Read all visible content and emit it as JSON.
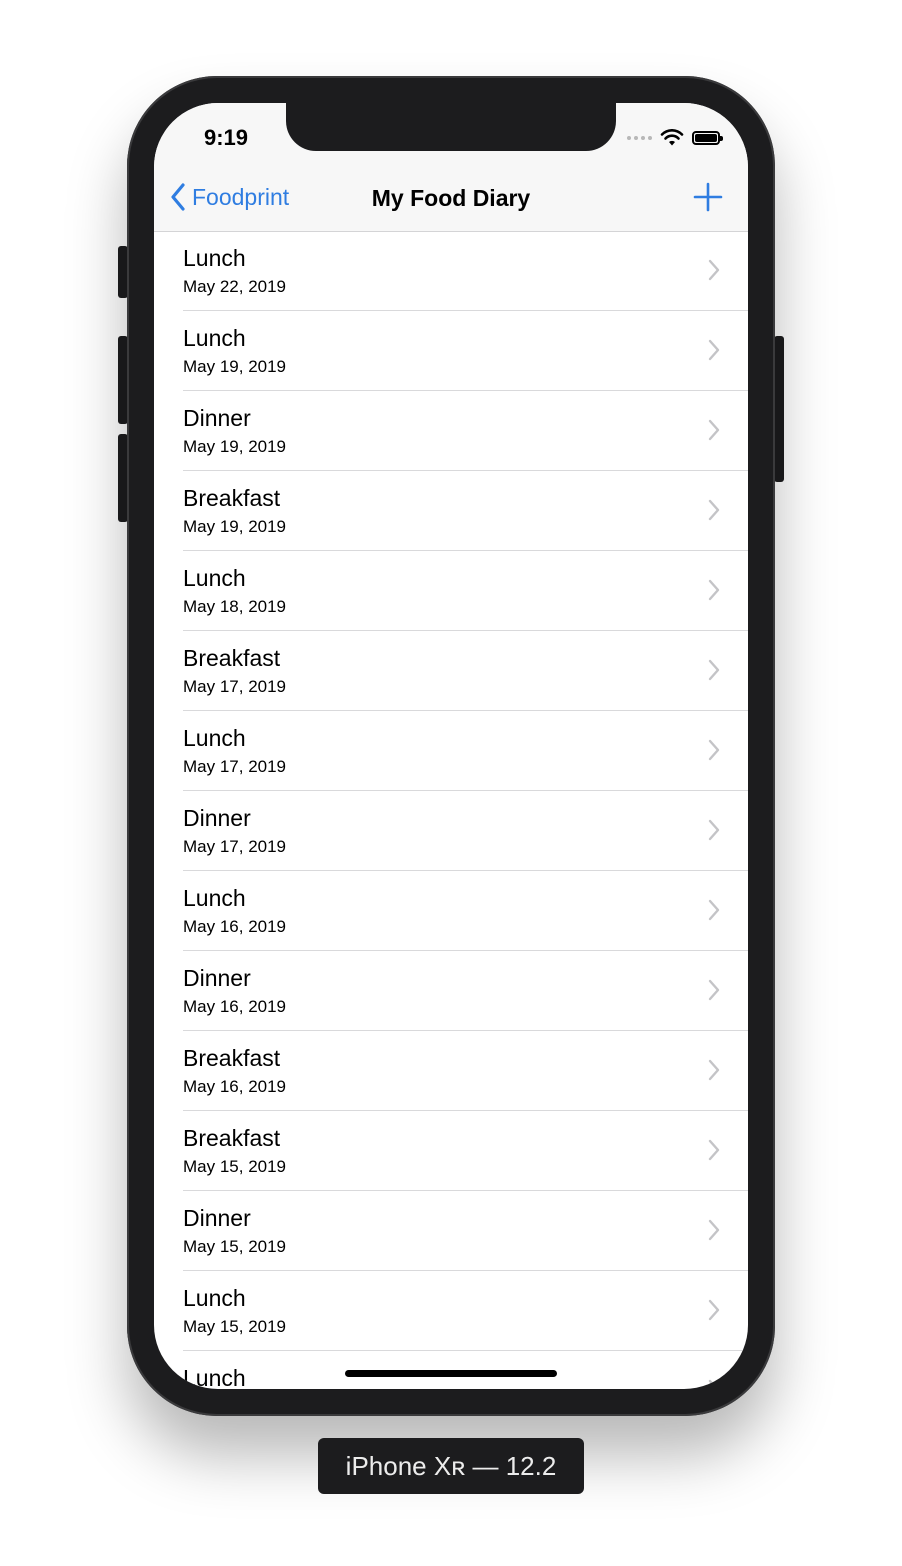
{
  "status_bar": {
    "time": "9:19"
  },
  "nav": {
    "back_label": "Foodprint",
    "title": "My Food Diary",
    "add_icon": "plus-icon"
  },
  "colors": {
    "accent": "#2f7de1",
    "device": "#1c1c1e"
  },
  "entries": [
    {
      "meal": "Lunch",
      "date": "May 22, 2019"
    },
    {
      "meal": "Lunch",
      "date": "May 19, 2019"
    },
    {
      "meal": "Dinner",
      "date": "May 19, 2019"
    },
    {
      "meal": "Breakfast",
      "date": "May 19, 2019"
    },
    {
      "meal": "Lunch",
      "date": "May 18, 2019"
    },
    {
      "meal": "Breakfast",
      "date": "May 17, 2019"
    },
    {
      "meal": "Lunch",
      "date": "May 17, 2019"
    },
    {
      "meal": "Dinner",
      "date": "May 17, 2019"
    },
    {
      "meal": "Lunch",
      "date": "May 16, 2019"
    },
    {
      "meal": "Dinner",
      "date": "May 16, 2019"
    },
    {
      "meal": "Breakfast",
      "date": "May 16, 2019"
    },
    {
      "meal": "Breakfast",
      "date": "May 15, 2019"
    },
    {
      "meal": "Dinner",
      "date": "May 15, 2019"
    },
    {
      "meal": "Lunch",
      "date": "May 15, 2019"
    },
    {
      "meal": "Lunch",
      "date": ""
    }
  ],
  "device_label": "iPhone Xʀ — 12.2"
}
